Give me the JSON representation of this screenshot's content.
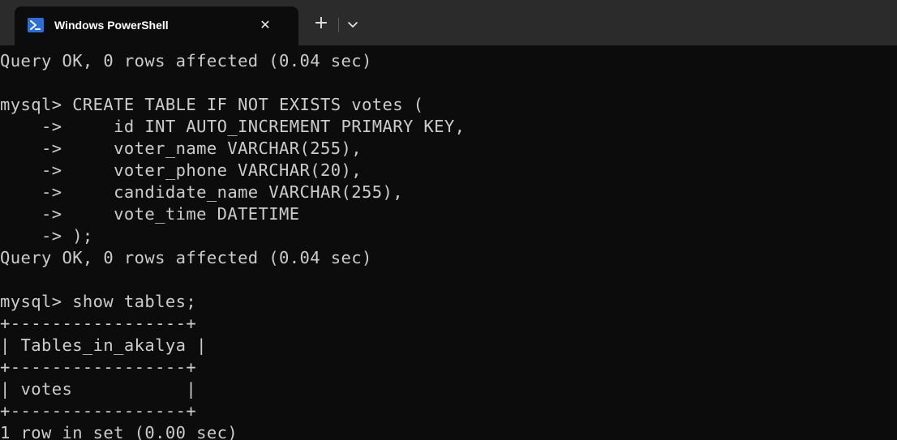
{
  "window": {
    "tab_title": "Windows PowerShell",
    "tab_icon": "powershell-icon",
    "close_icon": "close-icon",
    "new_tab_icon": "plus-icon",
    "dropdown_icon": "chevron-down-icon",
    "colors": {
      "titlebar": "#2b2b2b",
      "terminal_bg": "#0c0c0c",
      "text": "#cccccc",
      "powershell_accent": "#2c6fdb"
    }
  },
  "terminal": {
    "lines": [
      "Query OK, 0 rows affected (0.04 sec)",
      "",
      "mysql> CREATE TABLE IF NOT EXISTS votes (",
      "    ->     id INT AUTO_INCREMENT PRIMARY KEY,",
      "    ->     voter_name VARCHAR(255),",
      "    ->     voter_phone VARCHAR(20),",
      "    ->     candidate_name VARCHAR(255),",
      "    ->     vote_time DATETIME",
      "    -> );",
      "Query OK, 0 rows affected (0.04 sec)",
      "",
      "mysql> show tables;",
      "+-----------------+",
      "| Tables_in_akalya |",
      "+-----------------+",
      "| votes           |",
      "+-----------------+",
      "1 row in set (0.00 sec)"
    ]
  }
}
